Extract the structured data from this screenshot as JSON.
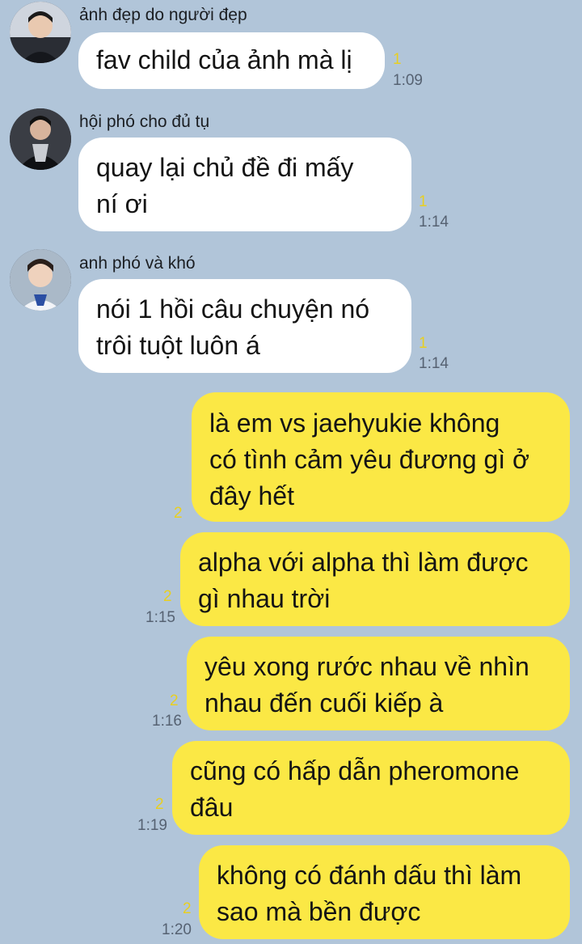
{
  "messages": [
    {
      "sender": "ảnh đẹp do người đẹp",
      "text": "fav child của ảnh mà lị",
      "unread": "1",
      "time": "1:09"
    },
    {
      "sender": "hội phó cho đủ tụ",
      "text": "quay lại chủ đề đi mấy\nní ơi",
      "unread": "1",
      "time": "1:14"
    },
    {
      "sender": "anh phó và khó",
      "text": "nói 1 hồi câu chuyện nó\ntrôi tuột luôn á",
      "unread": "1",
      "time": "1:14"
    },
    {
      "text": "là em vs jaehyukie không\ncó tình cảm yêu đương gì ở\nđây hết",
      "unread": "2",
      "time": ""
    },
    {
      "text": "alpha với alpha thì làm được\ngì nhau trời",
      "unread": "2",
      "time": "1:15"
    },
    {
      "text": "yêu xong rước nhau về nhìn\nnhau đến cuối kiếp à",
      "unread": "2",
      "time": "1:16"
    },
    {
      "text": "cũng có hấp dẫn pheromone\nđâu",
      "unread": "2",
      "time": "1:19"
    },
    {
      "text": "không có đánh dấu thì làm\nsao mà bền được",
      "unread": "2",
      "time": "1:20"
    }
  ],
  "colors": {
    "background": "#b1c5d9",
    "incoming_bubble": "#ffffff",
    "outgoing_bubble": "#fbe845",
    "unread": "#e8cf22"
  }
}
